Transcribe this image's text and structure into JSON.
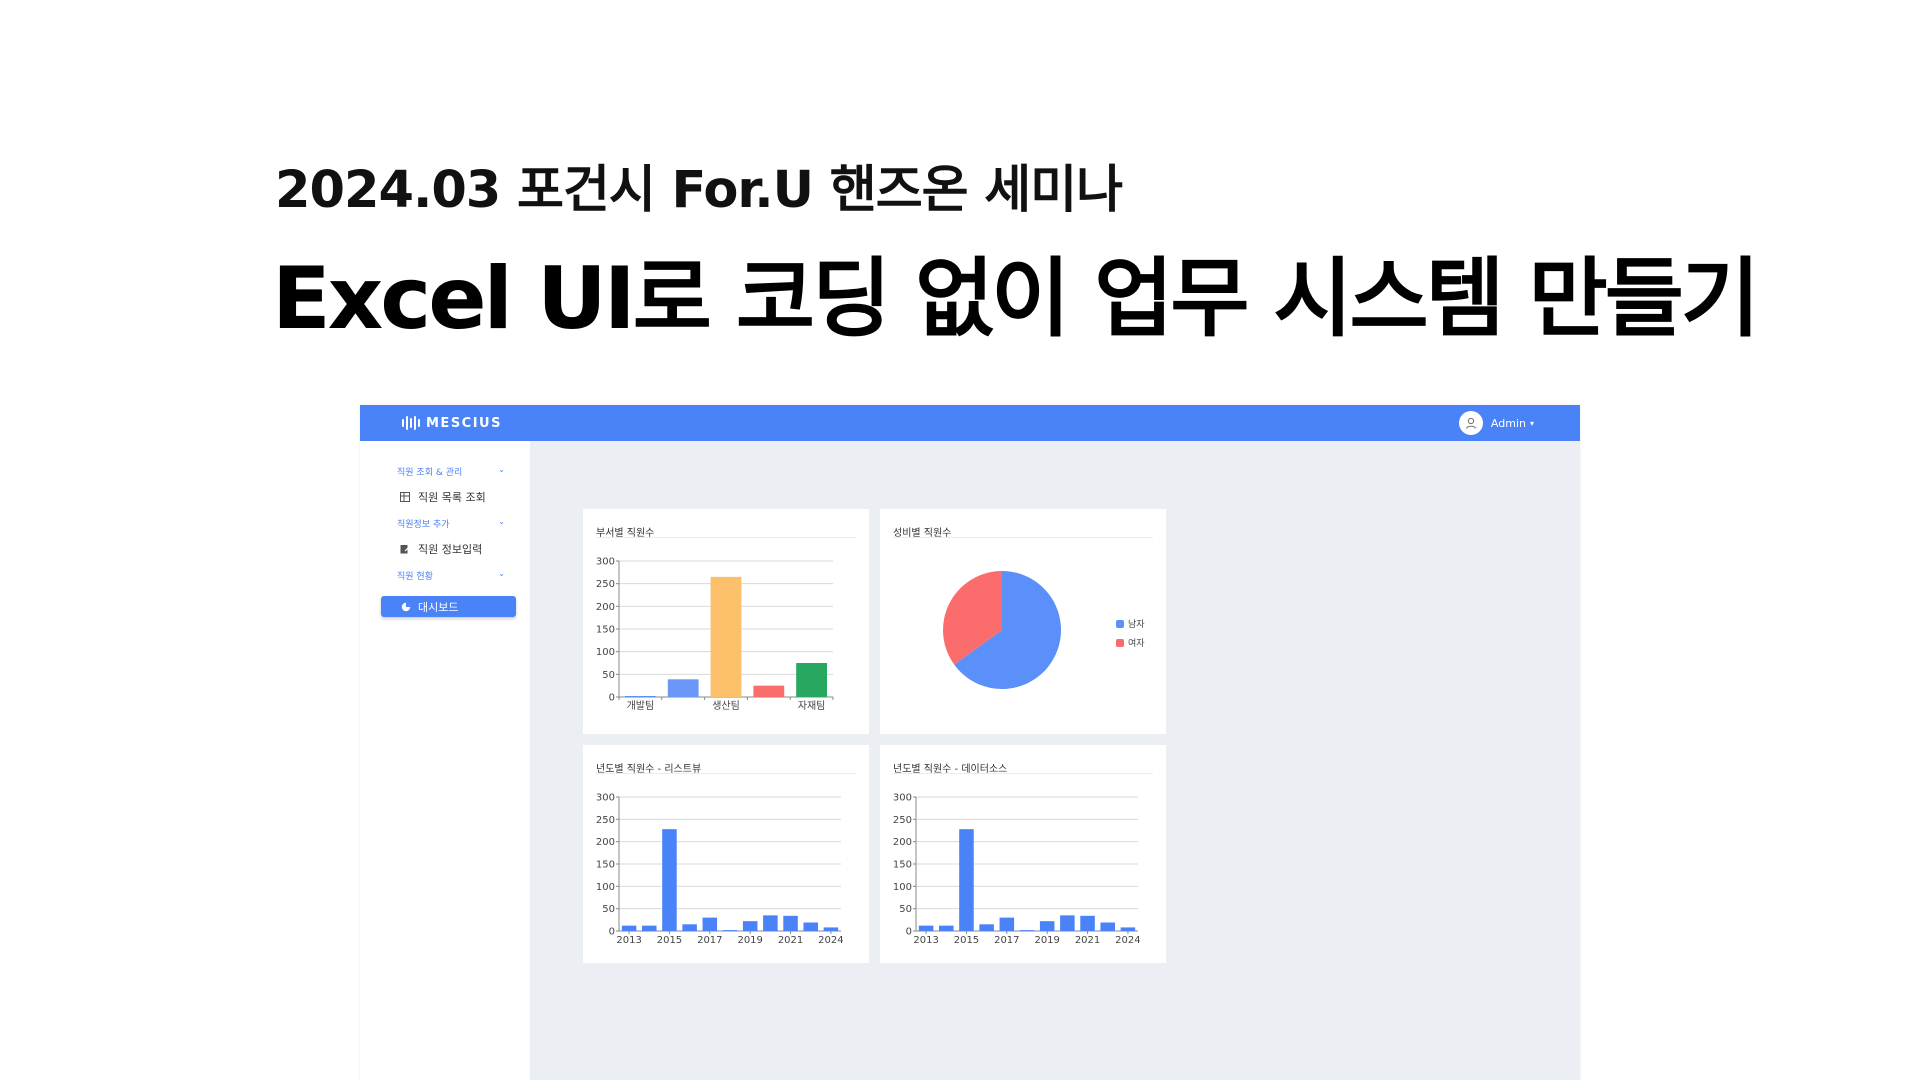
{
  "slide": {
    "subtitle": "2024.03 포건시 For.U 핸즈온 세미나",
    "headline": "Excel UI로 코딩 없이 업무 시스템 만들기"
  },
  "app": {
    "brand": "MESCIUS",
    "user_name": "Admin",
    "accent": "#4a82f7",
    "sidebar": {
      "groups": [
        {
          "label": "직원 조회 & 관리",
          "items": [
            {
              "label": "직원 목록 조회",
              "icon": "table-icon"
            }
          ]
        },
        {
          "label": "직원정보 추가",
          "items": [
            {
              "label": "직원 정보입력",
              "icon": "edit-icon"
            }
          ]
        },
        {
          "label": "직원 현황",
          "items": [
            {
              "label": "대시보드",
              "icon": "pie-chart-icon",
              "active": true
            }
          ]
        }
      ]
    },
    "cards": {
      "dept": {
        "title": "부서별 직원수"
      },
      "gender": {
        "title": "성비별 직원수"
      },
      "year_list": {
        "title": "년도별 직원수 - 리스트뷰"
      },
      "year_source": {
        "title": "년도별 직원수 - 데이터소스"
      }
    }
  },
  "chart_data": [
    {
      "id": "dept",
      "type": "bar",
      "title": "부서별 직원수",
      "categories": [
        "개발팀",
        "",
        "생산팀",
        "",
        "자재팀"
      ],
      "values": [
        2,
        39,
        265,
        25,
        75
      ],
      "colors": [
        "#4a82f7",
        "#6b97f8",
        "#fcc06b",
        "#fb6d6d",
        "#27a760"
      ],
      "ylim": [
        0,
        300
      ],
      "yticks": [
        0,
        50,
        100,
        150,
        200,
        250,
        300
      ],
      "grid": true
    },
    {
      "id": "gender",
      "type": "pie",
      "title": "성비별 직원수",
      "labels": [
        "남자",
        "여자"
      ],
      "values": [
        65,
        35
      ],
      "colors": [
        "#5b8ff9",
        "#fb6d6d"
      ],
      "legend": "right"
    },
    {
      "id": "year_list",
      "type": "bar",
      "title": "년도별 직원수 - 리스트뷰",
      "categories": [
        "2013",
        "2014",
        "2015",
        "2016",
        "2017",
        "2018",
        "2019",
        "2020",
        "2021",
        "2022",
        "2024"
      ],
      "tick_labels": [
        "2013",
        "2015",
        "2017",
        "2019",
        "2021",
        "2024"
      ],
      "values": [
        12,
        12,
        228,
        15,
        30,
        2,
        22,
        35,
        34,
        19,
        8
      ],
      "color": "#4a82f7",
      "ylim": [
        0,
        300
      ],
      "yticks": [
        0,
        50,
        100,
        150,
        200,
        250,
        300
      ],
      "grid": true
    },
    {
      "id": "year_source",
      "type": "bar",
      "title": "년도별 직원수 - 데이터소스",
      "categories": [
        "2013",
        "2014",
        "2015",
        "2016",
        "2017",
        "2018",
        "2019",
        "2020",
        "2021",
        "2022",
        "2024"
      ],
      "tick_labels": [
        "2013",
        "2015",
        "2017",
        "2019",
        "2021",
        "2024"
      ],
      "values": [
        12,
        12,
        228,
        15,
        30,
        2,
        22,
        35,
        34,
        19,
        8
      ],
      "color": "#4a82f7",
      "ylim": [
        0,
        300
      ],
      "yticks": [
        0,
        50,
        100,
        150,
        200,
        250,
        300
      ],
      "grid": true
    }
  ]
}
